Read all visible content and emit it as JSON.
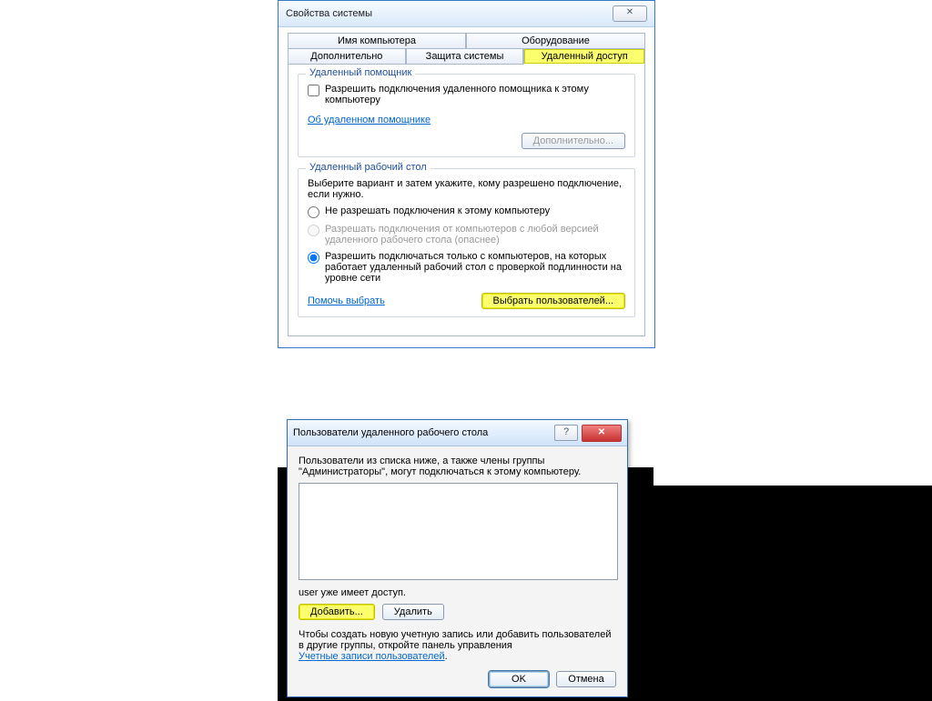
{
  "win1": {
    "title": "Свойства системы",
    "tabs": [
      "Имя компьютера",
      "Оборудование",
      "Дополнительно",
      "Защита системы",
      "Удаленный доступ"
    ],
    "group1": {
      "title": "Удаленный помощник",
      "checkbox": "Разрешить подключения удаленного помощника к этому компьютеру",
      "link": "Об удаленном помощнике",
      "btn": "Дополнительно..."
    },
    "group2": {
      "title": "Удаленный рабочий стол",
      "instr": "Выберите вариант и затем укажите, кому разрешено подключение, если нужно.",
      "radio1": "Не разрешать подключения к этому компьютеру",
      "radio2": "Разрешать подключения от компьютеров с любой версией удаленного рабочего стола (опаснее)",
      "radio3": "Разрешить подключаться только с компьютеров, на которых работает удаленный рабочий стол с проверкой подлинности на уровне сети",
      "link": "Помочь выбрать",
      "btn": "Выбрать пользователей..."
    }
  },
  "win2": {
    "title": "Пользователи удаленного рабочего стола",
    "instr": "Пользователи из списка ниже, а также члены группы \"Администраторы\", могут подключаться к этому компьютеру.",
    "note": "user уже имеет доступ.",
    "add": "Добавить...",
    "remove": "Удалить",
    "hint": "Чтобы создать новую учетную запись или добавить пользователей в другие группы, откройте панель управления ",
    "link": "Учетные записи пользователей",
    "ok": "OK",
    "cancel": "Отмена"
  }
}
